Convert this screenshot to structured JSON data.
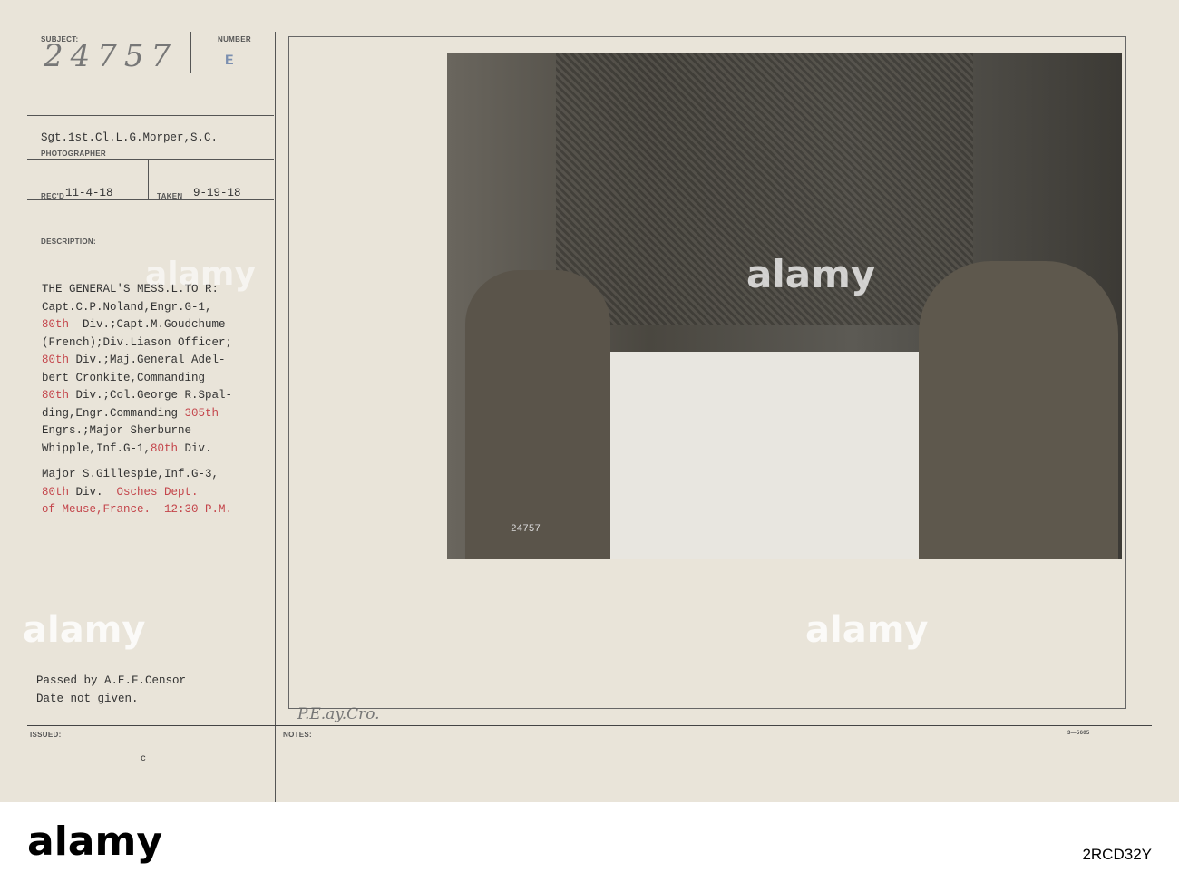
{
  "card": {
    "subject_label": "SUBJECT:",
    "subject_value": "24757",
    "number_label": "NUMBER",
    "number_value": "E",
    "photographer": "Sgt.1st.Cl.L.G.Morper,S.C.",
    "photographer_label": "PHOTOGRAPHER",
    "recd_label": "REC'D",
    "recd_value": "11-4-18",
    "taken_label": "TAKEN",
    "taken_value": "9-19-18",
    "description_label": "DESCRIPTION:",
    "description_lines": [
      {
        "parts": [
          {
            "t": "THE GENERAL'S MESS.L.TO R:",
            "red": false
          }
        ]
      },
      {
        "parts": [
          {
            "t": "Capt.C.P.Noland,Engr.G-1,",
            "red": false
          }
        ]
      },
      {
        "parts": [
          {
            "t": "80th",
            "red": true
          },
          {
            "t": "  Div.;Capt.M.Goudchume",
            "red": false
          }
        ]
      },
      {
        "parts": [
          {
            "t": "(French);Div.Liason Officer;",
            "red": false
          }
        ]
      },
      {
        "parts": [
          {
            "t": "80th",
            "red": true
          },
          {
            "t": " Div.;Maj.General Adel-",
            "red": false
          }
        ]
      },
      {
        "parts": [
          {
            "t": "bert Cronkite,Commanding",
            "red": false
          }
        ]
      },
      {
        "parts": [
          {
            "t": "80th",
            "red": true
          },
          {
            "t": " Div.;Col.George R.Spal-",
            "red": false
          }
        ]
      },
      {
        "parts": [
          {
            "t": "ding,Engr.Commanding ",
            "red": false
          },
          {
            "t": "305th",
            "red": true
          }
        ]
      },
      {
        "parts": [
          {
            "t": "Engrs.;Major Sherburne",
            "red": false
          }
        ]
      },
      {
        "parts": [
          {
            "t": "Whipple,Inf.G-1,",
            "red": false
          },
          {
            "t": "80th",
            "red": true
          },
          {
            "t": " Div.",
            "red": false
          }
        ]
      }
    ],
    "description_lines2": [
      {
        "parts": [
          {
            "t": "Major S.Gillespie,Inf.G-3,",
            "red": false
          }
        ]
      },
      {
        "parts": [
          {
            "t": "80th",
            "red": true
          },
          {
            "t": " Div.  ",
            "red": false
          },
          {
            "t": "Osches Dept.",
            "red": true
          }
        ]
      },
      {
        "parts": [
          {
            "t": "of Meuse,France.  12:30 P.M.",
            "red": true
          }
        ]
      }
    ],
    "censor_line1": "Passed by A.E.F.Censor",
    "censor_line2": "Date not given.",
    "issued_label": "ISSUED:",
    "issued_value": "c",
    "notes_label": "NOTES:",
    "notes_value": "P.E.ay.Cro.",
    "form_number": "3—5605",
    "photo_stamp": "24757"
  },
  "watermark": {
    "brand": "alamy",
    "image_id": "2RCD32Y"
  }
}
